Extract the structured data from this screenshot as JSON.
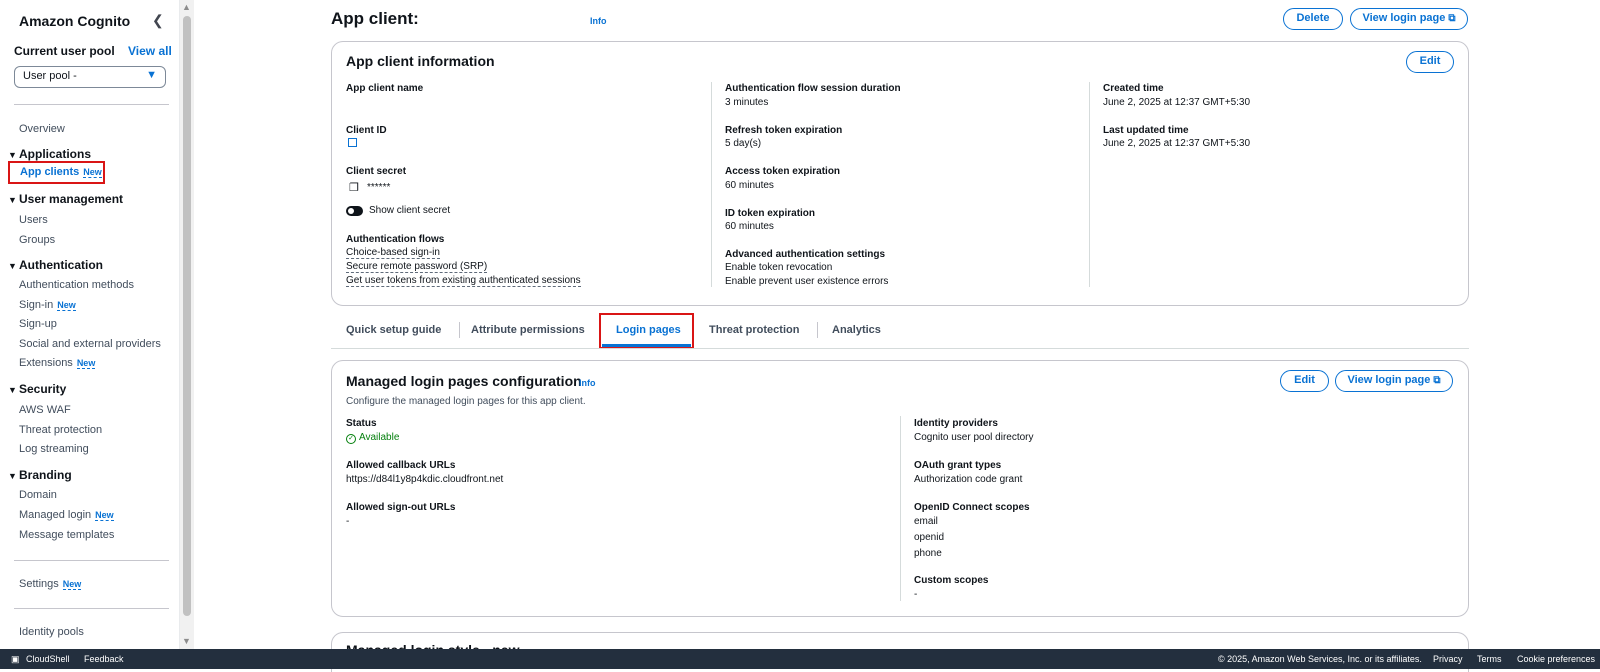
{
  "sidebar": {
    "title": "Amazon Cognito",
    "current_pool_label": "Current user pool",
    "view_all": "View all",
    "pool_select": "User pool -",
    "overview": "Overview",
    "applications": "Applications",
    "app_clients": "App clients",
    "user_management": "User management",
    "users": "Users",
    "groups": "Groups",
    "authentication": "Authentication",
    "auth_methods": "Authentication methods",
    "sign_in": "Sign-in",
    "sign_up": "Sign-up",
    "social": "Social and external providers",
    "extensions": "Extensions",
    "security": "Security",
    "aws_waf": "AWS WAF",
    "threat_protection": "Threat protection",
    "log_streaming": "Log streaming",
    "branding": "Branding",
    "domain": "Domain",
    "managed_login": "Managed login",
    "message_templates": "Message templates",
    "settings": "Settings",
    "identity_pools": "Identity pools",
    "new_badge": "New"
  },
  "header": {
    "title": "App client:",
    "info": "Info",
    "delete": "Delete",
    "view_login_page": "View login page"
  },
  "app_client_info": {
    "title": "App client information",
    "edit": "Edit",
    "col1": {
      "name_label": "App client name",
      "client_id_label": "Client ID",
      "client_secret_label": "Client secret",
      "client_secret_value": "******",
      "show_secret": "Show client secret",
      "auth_flows_label": "Authentication flows",
      "flows": [
        "Choice-based sign-in",
        "Secure remote password (SRP)",
        "Get user tokens from existing authenticated sessions"
      ]
    },
    "col2": {
      "session_label": "Authentication flow session duration",
      "session_value": "3 minutes",
      "refresh_label": "Refresh token expiration",
      "refresh_value": "5 day(s)",
      "access_label": "Access token expiration",
      "access_value": "60 minutes",
      "id_label": "ID token expiration",
      "id_value": "60 minutes",
      "advanced_label": "Advanced authentication settings",
      "advanced_1": "Enable token revocation",
      "advanced_2": "Enable prevent user existence errors"
    },
    "col3": {
      "created_label": "Created time",
      "created_value": "June 2, 2025 at 12:37 GMT+5:30",
      "updated_label": "Last updated time",
      "updated_value": "June 2, 2025 at 12:37 GMT+5:30"
    }
  },
  "tabs": [
    "Quick setup guide",
    "Attribute permissions",
    "Login pages",
    "Threat protection",
    "Analytics"
  ],
  "login_config": {
    "title": "Managed login pages configuration",
    "info": "Info",
    "description": "Configure the managed login pages for this app client.",
    "edit": "Edit",
    "view_login_page": "View login page",
    "status_label": "Status",
    "status_value": "Available",
    "callback_label": "Allowed callback URLs",
    "callback_value": "https://d84l1y8p4kdic.cloudfront.net",
    "signout_label": "Allowed sign-out URLs",
    "signout_value": "-",
    "idp_label": "Identity providers",
    "idp_value": "Cognito user pool directory",
    "oauth_label": "OAuth grant types",
    "oauth_value": "Authorization code grant",
    "oidc_label": "OpenID Connect scopes",
    "oidc_scopes": [
      "email",
      "openid",
      "phone"
    ],
    "custom_label": "Custom scopes",
    "custom_value": "-"
  },
  "next_section": {
    "title_partial": "Managed login style - new"
  },
  "footer": {
    "cloudshell": "CloudShell",
    "feedback": "Feedback",
    "copyright": "© 2025, Amazon Web Services, Inc. or its affiliates.",
    "privacy": "Privacy",
    "terms": "Terms",
    "cookie": "Cookie preferences"
  },
  "colors": {
    "link": "#0972d3",
    "highlight": "#d91515",
    "success": "#037f0c",
    "footer_bg": "#232f3e"
  }
}
